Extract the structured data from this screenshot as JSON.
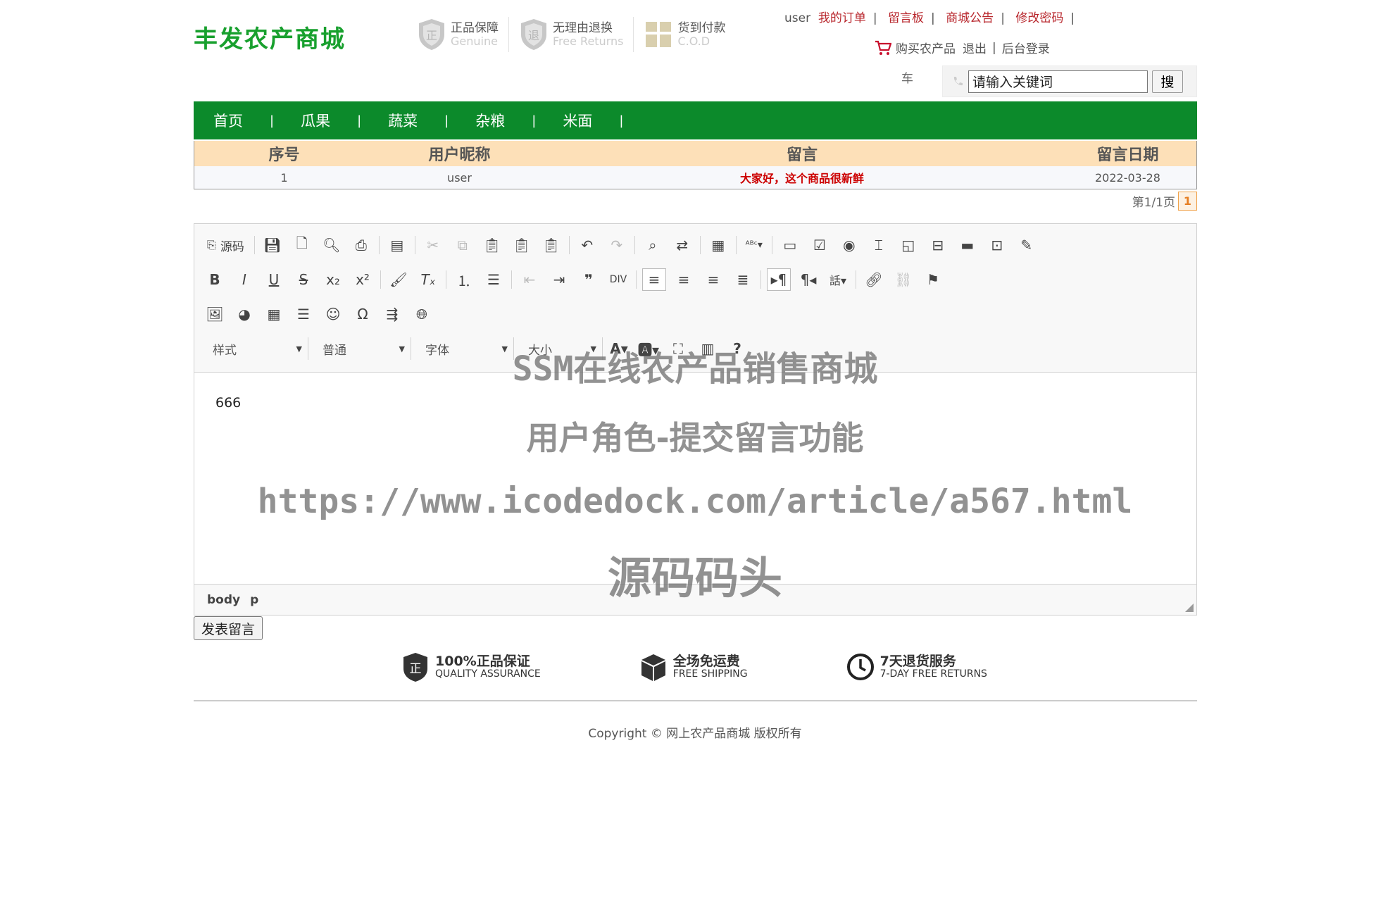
{
  "header": {
    "logo": "丰发农产商城",
    "badges": [
      {
        "cn": "正品保障",
        "en": "Genuine",
        "icon": "genuine-shield-icon"
      },
      {
        "cn": "无理由退换",
        "en": "Free Returns",
        "icon": "returns-shield-icon"
      },
      {
        "cn": "货到付款",
        "en": "C.O.D",
        "icon": "gift-box-icon"
      }
    ],
    "username": "user",
    "links": [
      "我的订单",
      "留言板",
      "商城公告",
      "修改密码"
    ],
    "cart_label": "购买农产品",
    "cart_overflow": "车",
    "logout": "退出",
    "admin_login": "后台登录",
    "search_placeholder": "请输入关键词",
    "search_value": "请输入关键词",
    "search_button": "搜"
  },
  "nav": [
    "首页",
    "瓜果",
    "蔬菜",
    "杂粮",
    "米面"
  ],
  "messages": {
    "headers": [
      "序号",
      "用户昵称",
      "留言",
      "留言日期"
    ],
    "rows": [
      {
        "no": "1",
        "user": "user",
        "content": "大家好，这个商品很新鲜",
        "date": "2022-03-28"
      }
    ],
    "pager_text": "第1/1页",
    "pager_current": "1"
  },
  "editor": {
    "source_label": "源码",
    "combos": [
      "样式",
      "普通",
      "字体",
      "大小"
    ],
    "content": "666",
    "path": [
      "body",
      "p"
    ]
  },
  "submit_label": "发表留言",
  "services": [
    {
      "cn": "100%正品保证",
      "en": "QUALITY ASSURANCE",
      "icon": "genuine-badge-icon"
    },
    {
      "cn": "全场免运费",
      "en": "FREE SHIPPING",
      "icon": "package-icon"
    },
    {
      "cn": "7天退货服务",
      "en": "7-DAY FREE RETURNS",
      "icon": "clock-icon"
    }
  ],
  "copyright": "Copyright © 网上农产品商城 版权所有",
  "watermark": {
    "line1": "SSM在线农产品销售商城",
    "line2": "用户角色-提交留言功能",
    "line3": "https://www.icodedock.com/article/a567.html",
    "line4": "源码码头"
  },
  "colors": {
    "nav_green": "#0c8a2b",
    "logo_green": "#18a02e",
    "link_red": "#b8262c",
    "table_header": "#fde0b8",
    "message_red": "#cc0000"
  }
}
